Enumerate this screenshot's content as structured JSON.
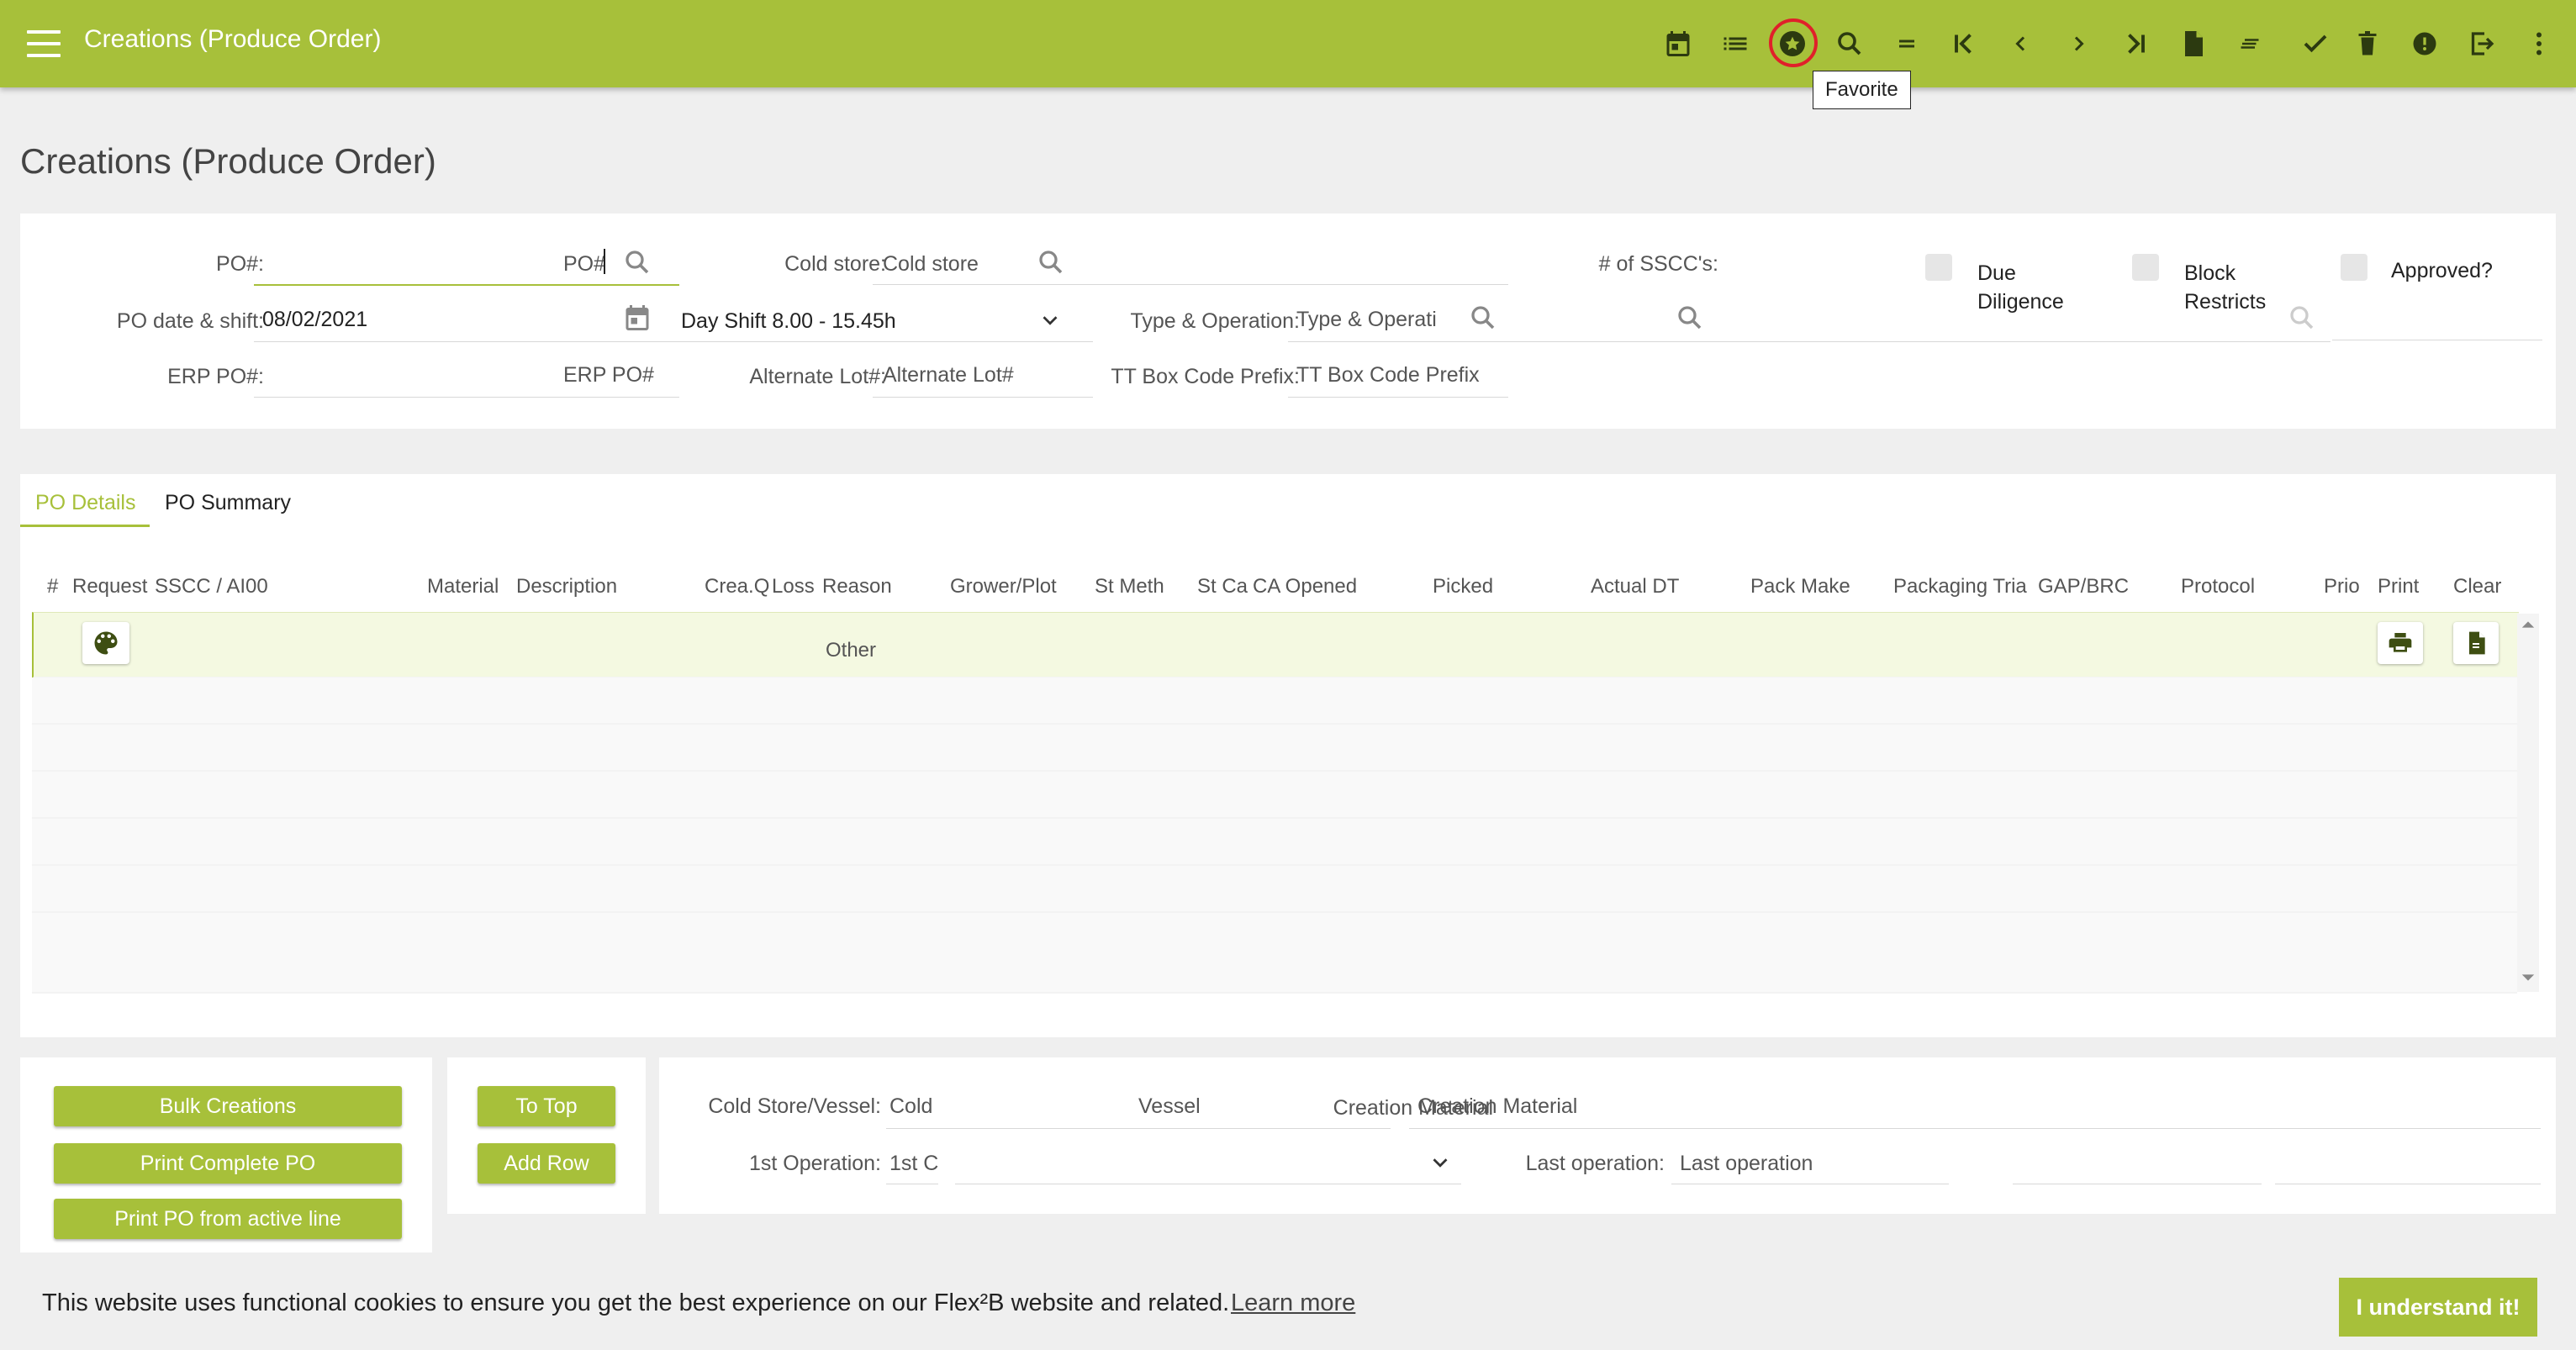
{
  "app": {
    "title": "Creations (Produce Order)",
    "tooltip": "Favorite",
    "accent_color": "#a7c03a",
    "toolbar_icons": [
      "calendar-icon",
      "list-icon",
      "favorite-star-icon",
      "search-icon",
      "equals-icon",
      "first-record-icon",
      "previous-icon",
      "next-icon",
      "last-record-icon",
      "new-document-icon",
      "notes-icon",
      "check-icon",
      "delete-icon",
      "alert-icon",
      "exit-icon",
      "more-vert-icon"
    ]
  },
  "page": {
    "title": "Creations (Produce Order)"
  },
  "form": {
    "po_label": "PO#:",
    "po_placeholder": "PO#",
    "cold_store_label": "Cold store:",
    "cold_store_placeholder": "Cold store",
    "sscc_label": "# of SSCC's:",
    "due_diligence_label": "Due Diligence",
    "block_restricts_label": "Block Restricts",
    "approved_label": "Approved?",
    "po_date_label": "PO date & shift:",
    "po_date_value": "08/02/2021",
    "shift_value": "Day Shift 8.00 - 15.45h",
    "type_operation_label": "Type & Operation:",
    "type_operation_placeholder": "Type & Operati",
    "erp_po_label": "ERP PO#:",
    "erp_po_placeholder": "ERP PO#",
    "alt_lot_label": "Alternate Lot#:",
    "alt_lot_placeholder": "Alternate Lot#",
    "tt_box_label": "TT Box Code Prefix:",
    "tt_box_placeholder": "TT Box Code Prefix"
  },
  "tabs": {
    "details": "PO Details",
    "summary": "PO Summary"
  },
  "table": {
    "headers": {
      "num": "#",
      "request": "Request",
      "sscc": "SSCC / AI00",
      "material": "Material",
      "description": "Description",
      "crea_q": "Crea.Q",
      "loss": "Loss",
      "reason": "Reason",
      "grower": "Grower/Plot",
      "st_meth": "St Meth",
      "st_ca": "St Ca",
      "ca_opened": "CA Opened",
      "picked": "Picked",
      "actual_dt": "Actual DT",
      "pack_make": "Pack Make",
      "packaging": "Packaging Tria",
      "gap_brc": "GAP/BRC",
      "protocol": "Protocol",
      "prio": "Prio",
      "print": "Print",
      "clear": "Clear"
    },
    "rows": [
      {
        "reason": "Other"
      }
    ]
  },
  "actions": {
    "bulk": "Bulk Creations",
    "print_complete": "Print Complete PO",
    "print_active": "Print PO from active line",
    "to_top": "To Top",
    "add_row": "Add Row"
  },
  "bottom_form": {
    "cold_vessel_label": "Cold Store/Vessel:",
    "cold_placeholder": "Cold",
    "vessel_placeholder": "Vessel",
    "creation_material_label": "Creation Material",
    "creation_material_placeholder": "Creation Material",
    "first_op_label": "1st Operation:",
    "first_op_placeholder": "1st C",
    "last_op_label": "Last operation:",
    "last_op_placeholder": "Last operation"
  },
  "cookie": {
    "text": "This website uses functional cookies to ensure you get the best experience on our Flex²B website and related.",
    "link": "Learn more",
    "button": "I understand it!"
  }
}
